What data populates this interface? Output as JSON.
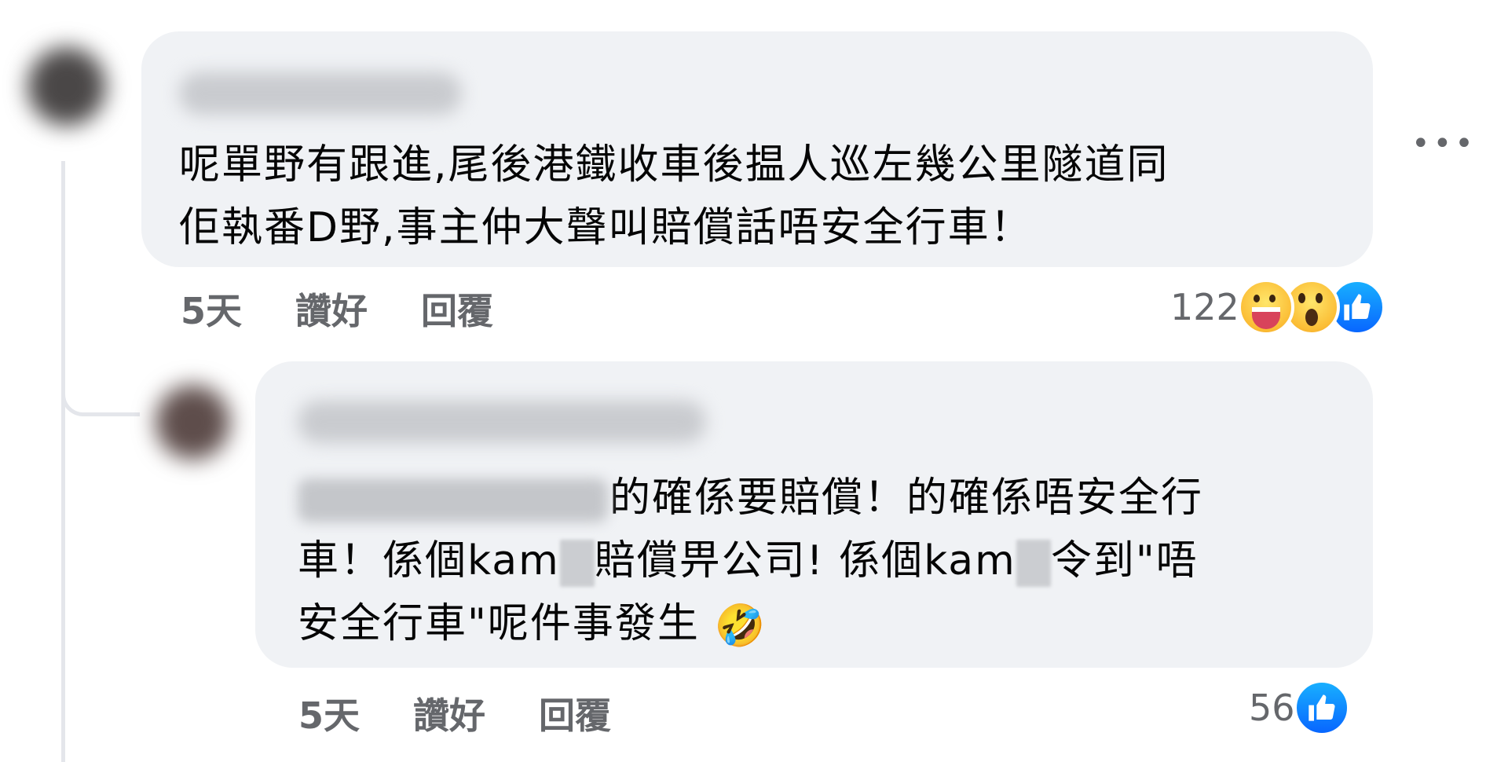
{
  "comments": [
    {
      "text": "呢單野有跟進,尾後港鐵收車後揾人巡左幾公里隧道同\n佢執番D野,事主仲大聲叫賠償話唔安全行車！",
      "time": "5天",
      "like_label": "讚好",
      "reply_label": "回覆",
      "reaction_count": "122",
      "reactions": [
        "haha-icon",
        "wow-icon",
        "like-icon"
      ]
    }
  ],
  "reply": {
    "text_line1": "的確係要賠償！的確係唔安全行",
    "text_line2a": "車！係個kam",
    "text_line2b": "賠償畀公司! 係個kam",
    "text_line2c": "令到\"唔",
    "text_line3": "安全行車\"呢件事發生 ",
    "emoji": "🤣",
    "time": "5天",
    "like_label": "讚好",
    "reply_label": "回覆",
    "reaction_count": "56",
    "reactions": [
      "like-icon"
    ]
  },
  "more_icon": "more-options-icon",
  "colors": {
    "bubble": "#f0f2f5",
    "meta_text": "#65676b",
    "like_blue": "#0866ff"
  }
}
